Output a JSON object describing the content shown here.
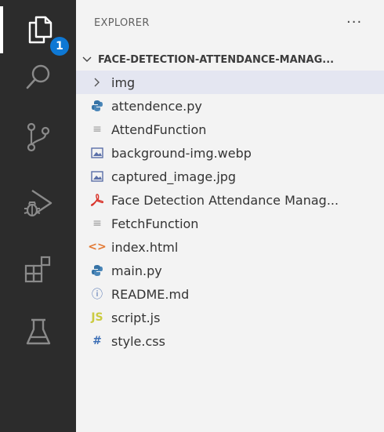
{
  "activity_bar": {
    "explorer_badge": "1",
    "items": [
      {
        "name": "explorer",
        "icon": "files-icon"
      },
      {
        "name": "search",
        "icon": "search-icon"
      },
      {
        "name": "source-control",
        "icon": "source-control-icon"
      },
      {
        "name": "run-debug",
        "icon": "run-debug-icon"
      },
      {
        "name": "extensions",
        "icon": "extensions-icon"
      },
      {
        "name": "testing",
        "icon": "beaker-icon"
      }
    ]
  },
  "explorer": {
    "title": "EXPLORER",
    "more": "···",
    "section_title": "FACE-DETECTION-ATTENDANCE-MANAG...",
    "items": [
      {
        "label": "img",
        "icon": "chevron-right-icon",
        "glyph": ">",
        "kind": "folder"
      },
      {
        "label": "attendence.py",
        "icon": "python-icon",
        "glyph": "",
        "kind": "py"
      },
      {
        "label": "AttendFunction",
        "icon": "text-file-icon",
        "glyph": "≡",
        "kind": "txt"
      },
      {
        "label": "background-img.webp",
        "icon": "image-file-icon",
        "glyph": "",
        "kind": "img"
      },
      {
        "label": "captured_image.jpg",
        "icon": "image-file-icon",
        "glyph": "",
        "kind": "img"
      },
      {
        "label": "Face Detection Attendance Manag...",
        "icon": "pdf-icon",
        "glyph": "",
        "kind": "pdf"
      },
      {
        "label": "FetchFunction",
        "icon": "text-file-icon",
        "glyph": "≡",
        "kind": "txt"
      },
      {
        "label": "index.html",
        "icon": "html-icon",
        "glyph": "<>",
        "kind": "html"
      },
      {
        "label": "main.py",
        "icon": "python-icon",
        "glyph": "",
        "kind": "py"
      },
      {
        "label": "README.md",
        "icon": "info-icon",
        "glyph": "ⓘ",
        "kind": "info"
      },
      {
        "label": "script.js",
        "icon": "javascript-icon",
        "glyph": "JS",
        "kind": "js"
      },
      {
        "label": "style.css",
        "icon": "css-icon",
        "glyph": "#",
        "kind": "css"
      }
    ]
  },
  "colors": {
    "activity_bg": "#2c2c2c",
    "sidebar_bg": "#f3f3f3",
    "selected_row": "#e4e6f1",
    "badge": "#0e78d4"
  }
}
